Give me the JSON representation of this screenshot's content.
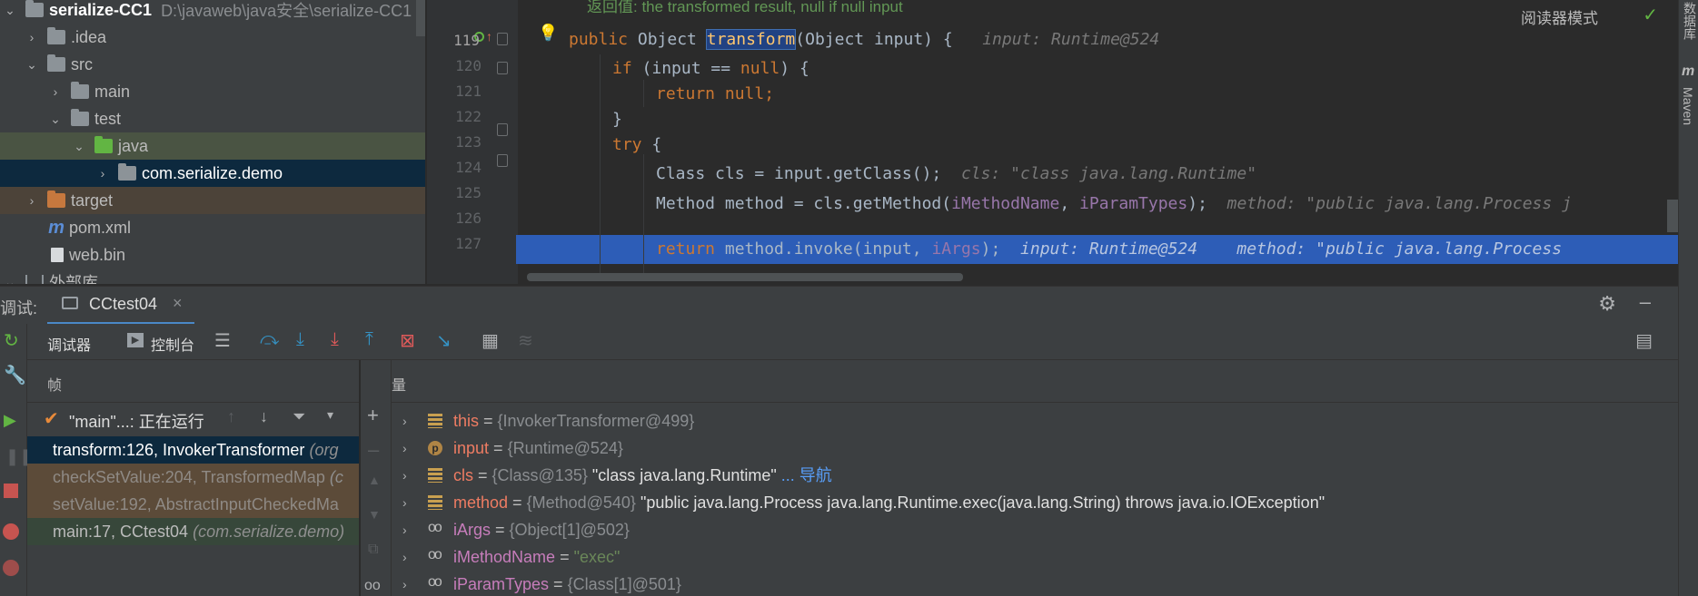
{
  "project": {
    "root_name": "serialize-CC1",
    "root_path": "D:\\javaweb\\java安全\\serialize-CC1",
    "items": [
      {
        "label": ".idea"
      },
      {
        "label": "src"
      },
      {
        "label": "main"
      },
      {
        "label": "test"
      },
      {
        "label": "java"
      },
      {
        "label": "com.serialize.demo"
      },
      {
        "label": "target"
      },
      {
        "label": "pom.xml"
      },
      {
        "label": "web.bin"
      },
      {
        "label": "外部库"
      }
    ]
  },
  "editor": {
    "comment_top": "返回值: the transformed result, null if null input",
    "reader_mode": "阅读器模式",
    "lines": [
      {
        "n": "119",
        "a": "public",
        "b": " Object ",
        "c": "transform",
        "d": "(Object input) {",
        "hint": "input: Runtime@524"
      },
      {
        "n": "120",
        "a": "if",
        "b": " (input == ",
        "c": "null",
        "d": ") {"
      },
      {
        "n": "121",
        "a": "return",
        "b": " ",
        "c": "null",
        "d": ";"
      },
      {
        "n": "122",
        "d": "}"
      },
      {
        "n": "123",
        "a": "try",
        "d": " {"
      },
      {
        "n": "124",
        "d": "Class cls = input.getClass();",
        "hint": "cls: \"class java.lang.Runtime\""
      },
      {
        "n": "125",
        "d1": "Method method = cls.getMethod(",
        "f1": "iMethodName",
        "d2": ", ",
        "f2": "iParamTypes",
        "d3": ");",
        "hint": "method: \"public java.lang.Process j"
      },
      {
        "n": "126",
        "a": "return",
        "d1": " method.invoke(input, ",
        "f1": "iArgs",
        "d2": ");",
        "hint": "input: Runtime@524    method: \"public java.lang.Process"
      },
      {
        "n": "127"
      }
    ]
  },
  "right_strip": {
    "db_label": "数据库",
    "maven_label": "Maven"
  },
  "debug": {
    "title": "调试:",
    "session_tab": "CCtest04",
    "tab_debugger": "调试器",
    "tab_console": "控制台",
    "frames_header": "帧",
    "vars_header": "变量",
    "thread": "\"main\"...: 正在运行",
    "frames": [
      {
        "method": "transform:126, InvokerTransformer",
        "pkg": "(org"
      },
      {
        "method": "checkSetValue:204, TransformedMap",
        "pkg": "(c"
      },
      {
        "method": "setValue:192, AbstractInputCheckedMa",
        "pkg": ""
      },
      {
        "method": "main:17, CCtest04",
        "pkg": "(com.serialize.demo)"
      }
    ],
    "variables": [
      {
        "name": "this",
        "eq": " = ",
        "type": "{InvokerTransformer@499}",
        "value": "",
        "extra": ""
      },
      {
        "name": "input",
        "eq": " = ",
        "type": "{Runtime@524}",
        "value": "",
        "extra": ""
      },
      {
        "name": "cls",
        "eq": " = ",
        "type": "{Class@135}",
        "value": " \"class java.lang.Runtime\"",
        "extra": " ... 导航"
      },
      {
        "name": "method",
        "eq": " = ",
        "type": "{Method@540}",
        "value": " \"public java.lang.Process java.lang.Runtime.exec(java.lang.String) throws java.io.IOException\"",
        "extra": ""
      },
      {
        "name": "iArgs",
        "eq": " = ",
        "type": "{Object[1]@502}",
        "value": "",
        "extra": ""
      },
      {
        "name": "iMethodName",
        "eq": " = ",
        "type": "",
        "value": "\"exec\"",
        "extra": ""
      },
      {
        "name": "iParamTypes",
        "eq": " = ",
        "type": "{Class[1]@501}",
        "value": "",
        "extra": ""
      }
    ]
  }
}
